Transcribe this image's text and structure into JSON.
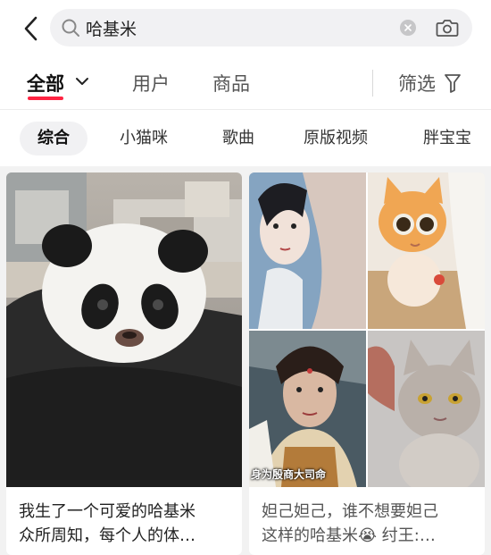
{
  "search": {
    "query": "哈基米"
  },
  "tabs": {
    "all": "全部",
    "users": "用户",
    "goods": "商品",
    "filter": "筛选"
  },
  "chips": [
    "综合",
    "小猫咪",
    "歌曲",
    "原版视频",
    "胖宝宝"
  ],
  "cards": [
    {
      "caption_line1": "我生了一个可爱的哈基米",
      "caption_line2": "众所周知，每个人的体…"
    },
    {
      "overlay": "身为殷商大司命",
      "caption_line1": "妲己妲己，谁不想要妲己",
      "caption_line2": "这样的哈基米😭 纣王:…"
    }
  ],
  "colors": {
    "accent": "#ff2442",
    "background": "#f2f2f2",
    "search_bg": "#f1f1f3"
  },
  "icons": [
    "back-arrow-icon",
    "search-icon",
    "clear-icon",
    "camera-icon",
    "chevron-down-icon",
    "filter-icon"
  ]
}
